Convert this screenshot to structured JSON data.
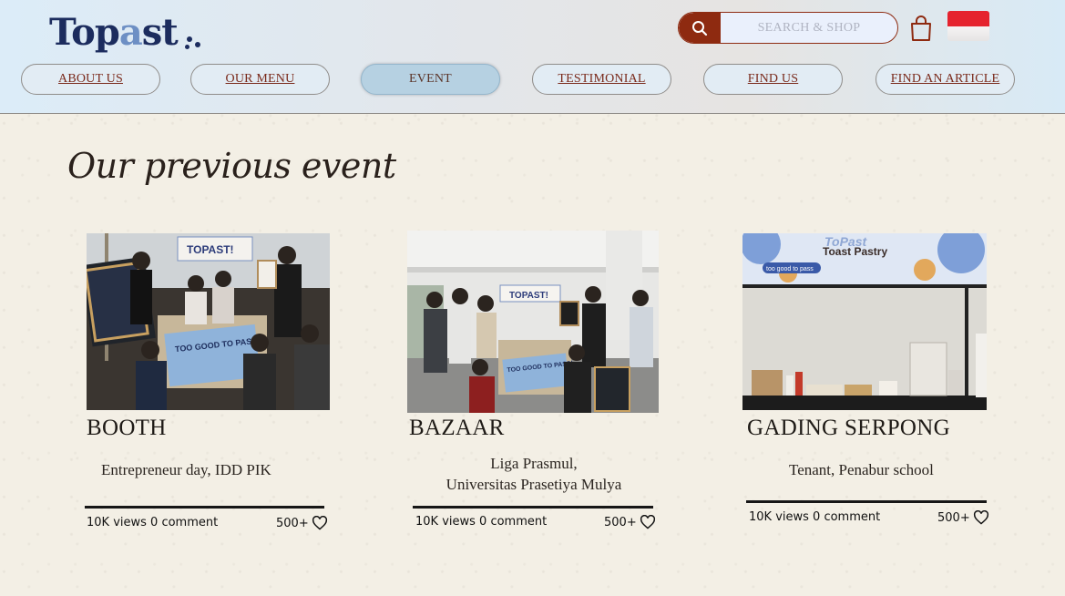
{
  "header": {
    "logo_text": "Topast",
    "search": {
      "placeholder": "SEARCH & SHOP"
    },
    "nav": [
      {
        "label": "ABOUT US"
      },
      {
        "label": "OUR MENU"
      },
      {
        "label": "EVENT"
      },
      {
        "label": "TESTIMONIAL"
      },
      {
        "label": "FIND US"
      },
      {
        "label": "FIND AN ARTICLE"
      }
    ],
    "active_nav": "EVENT"
  },
  "main": {
    "title": "Our previous event",
    "cards": [
      {
        "title": "BOOTH",
        "subtitle": "Entrepreneur day, IDD PIK",
        "stats": "10K views 0 comment",
        "likes": "500+",
        "photo_text": [
          "TOPAST!",
          "TOO GOOD TO PASS!"
        ]
      },
      {
        "title": "BAZAAR",
        "subtitle_line1": "Liga Prasmul,",
        "subtitle_line2": "Universitas Prasetiya Mulya",
        "stats": "10K views 0 comment",
        "likes": "500+",
        "photo_text": [
          "TOPAST!",
          "TOO GOOD TO PASS!"
        ]
      },
      {
        "title": "GADING SERPONG",
        "subtitle": "Tenant, Penabur school",
        "stats": "10K views 0 comment",
        "likes": "500+",
        "photo_text": [
          "ToPast",
          "Toast Pastry",
          "too good to pass"
        ]
      }
    ]
  },
  "colors": {
    "brand_navy": "#1c2c5e",
    "accent_rust": "#8e2a10",
    "nav_active": "#b6d1e2",
    "flag_red": "#e5232e"
  },
  "icons": [
    "search-icon",
    "shopping-bag-icon",
    "indonesia-flag-icon",
    "heart-icon"
  ]
}
